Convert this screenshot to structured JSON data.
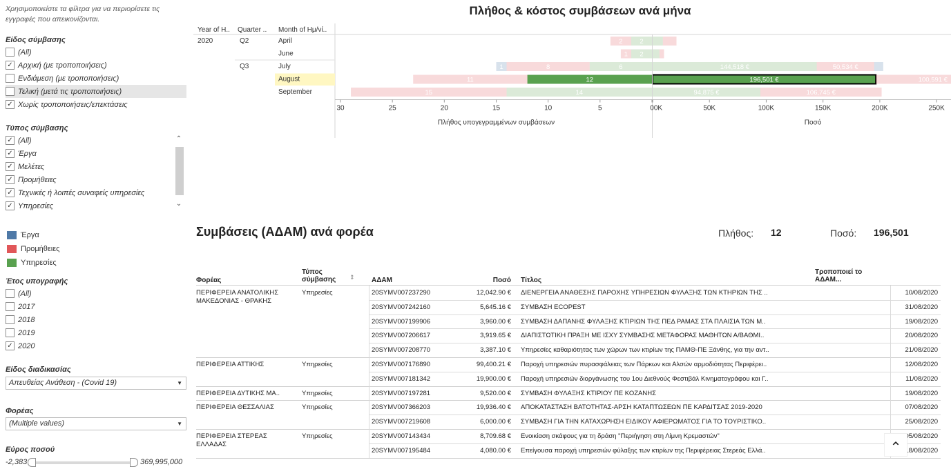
{
  "filters": {
    "hint": "Χρησιμοποιείστε τα φίλτρα για να περιορίσετε τις εγγραφές που απεικονίζονται.",
    "contract_kind": {
      "title": "Είδος σύμβασης",
      "items": [
        {
          "label": "(All)",
          "checked": false
        },
        {
          "label": "Αρχική (με τροποποιήσεις)",
          "checked": true
        },
        {
          "label": "Ενδιάμεση (με τροποποιήσεις)",
          "checked": false
        },
        {
          "label": "Τελική (μετά τις τροποποιήσεις)",
          "checked": false
        },
        {
          "label": "Χωρίς τροποποιήσεις/επεκτάσεις",
          "checked": true
        }
      ]
    },
    "contract_type": {
      "title": "Τύπος σύμβασης",
      "items": [
        {
          "label": "(All)",
          "checked": true
        },
        {
          "label": "Έργα",
          "checked": true
        },
        {
          "label": "Μελέτες",
          "checked": true
        },
        {
          "label": "Προμήθειες",
          "checked": true
        },
        {
          "label": "Τεχνικές ή λοιπές συναφείς υπηρεσίες",
          "checked": true
        },
        {
          "label": "Υπηρεσίες",
          "checked": true
        }
      ]
    },
    "legend": [
      {
        "label": "Έργα",
        "color": "#4e79a7"
      },
      {
        "label": "Προμήθειες",
        "color": "#e15759"
      },
      {
        "label": "Υπηρεσίες",
        "color": "#59a14f"
      }
    ],
    "sign_year": {
      "title": "Έτος υπογραφής",
      "items": [
        {
          "label": "(All)",
          "checked": false
        },
        {
          "label": "2017",
          "checked": false
        },
        {
          "label": "2018",
          "checked": false
        },
        {
          "label": "2019",
          "checked": false
        },
        {
          "label": "2020",
          "checked": true
        }
      ]
    },
    "procedure": {
      "title": "Είδος διαδικασίας",
      "value": "Απευθείας Ανάθεση - (Covid 19)"
    },
    "agency": {
      "title": "Φορέας",
      "value": "(Multiple values)"
    },
    "amount_range": {
      "title": "Εύρος ποσού",
      "min": "-2,383",
      "max": "369,995,000"
    }
  },
  "chart": {
    "title": "Πλήθος & κόστος συμβάσεων ανά μήνα",
    "headers": {
      "year": "Year of H..",
      "quarter": "Quarter ..",
      "month": "Month of Ημ/νί.."
    },
    "left_axis_label": "Πλήθος υπογεγραμμένων συμβάσεων",
    "right_axis_label": "Ποσό",
    "left_ticks": [
      "30",
      "25",
      "20",
      "15",
      "10",
      "5",
      "0"
    ],
    "right_ticks": [
      "0K",
      "50K",
      "100K",
      "150K",
      "200K",
      "250K"
    ]
  },
  "chart_data": {
    "type": "bar",
    "categories": [
      "2020 Q2 April",
      "2020 Q2 June",
      "2020 Q3 July",
      "2020 Q3 August",
      "2020 Q3 September"
    ],
    "years": [
      {
        "label": "2020",
        "row": 0
      }
    ],
    "quarters": [
      {
        "label": "Q2",
        "row": 0
      },
      {
        "label": "Q3",
        "row": 2
      }
    ],
    "months": [
      "April",
      "June",
      "July",
      "August",
      "September"
    ],
    "highlight": "August",
    "count_xlim": [
      0,
      30
    ],
    "amount_xlim": [
      0,
      270000
    ],
    "count_series": [
      {
        "name": "Έργα",
        "color": "#4e79a7",
        "values": [
          0,
          0,
          1,
          0,
          0
        ],
        "labels": [
          "",
          "",
          "1",
          "",
          ""
        ]
      },
      {
        "name": "Προμήθειες",
        "color": "#e15759",
        "values": [
          2,
          1,
          8,
          11,
          15
        ],
        "labels": [
          "2",
          "1",
          "8",
          "11",
          "15"
        ]
      },
      {
        "name": "Υπηρεσίες",
        "color": "#59a14f",
        "values": [
          2,
          2,
          6,
          12,
          14
        ],
        "labels": [
          "2",
          "2",
          "6",
          "12",
          "14"
        ]
      }
    ],
    "amount_series": [
      {
        "name": "Υπηρεσίες",
        "color": "#59a14f",
        "values": [
          9000,
          6000,
          144518,
          196501,
          94875
        ],
        "labels": [
          "",
          "",
          "144,518 €",
          "196,501 €",
          "94,875 €"
        ]
      },
      {
        "name": "Προμήθειες",
        "color": "#e15759",
        "values": [
          12000,
          4000,
          50534,
          100591,
          106745
        ],
        "labels": [
          "",
          "",
          "50,534 €",
          "100,591 €",
          "106,745 €"
        ]
      },
      {
        "name": "Έργα",
        "color": "#4e79a7",
        "values": [
          0,
          0,
          8000,
          0,
          0
        ],
        "labels": [
          "",
          "",
          "",
          "",
          ""
        ]
      }
    ]
  },
  "section": {
    "title": "Συμβάσεις (ΑΔΑΜ) ανά φορέα",
    "count_label": "Πλήθος:",
    "count_value": "12",
    "amount_label": "Ποσό:",
    "amount_value": "196,501"
  },
  "table": {
    "headers": {
      "agency": "Φορέας",
      "type": "Τύπος σύμβασης",
      "adam": "ΑΔΑΜ",
      "amount": "Ποσό",
      "title": "Τίτλος",
      "modifies": "Τροποποιεί το ΑΔΑΜ..."
    },
    "groups": [
      {
        "agency": "ΠΕΡΙΦΕΡΕΙΑ ΑΝΑΤΟΛΙΚΗΣ ΜΑΚΕΔΟΝΙΑΣ - ΘΡΑΚΗΣ",
        "type": "Υπηρεσίες",
        "rows": [
          {
            "adam": "20SYMV007237290",
            "amount": "12,042.90 €",
            "title": "ΔΙΕΝΕΡΓΕΙΑ ΑΝΑΘΕΣΗΣ ΠΑΡΟΧΗΣ ΥΠΗΡΕΣΙΩΝ ΦΥΛΑΞΗΣ ΤΩΝ ΚΤΗΡΙΩΝ ΤΗΣ ..",
            "date": "10/08/2020"
          },
          {
            "adam": "20SYMV007242160",
            "amount": "5,645.16 €",
            "title": "ΣΥΜΒΑΣΗ ECOPEST",
            "date": "31/08/2020"
          },
          {
            "adam": "20SYMV007199906",
            "amount": "3,960.00 €",
            "title": "ΣΥΜΒΑΣΗ ΔΑΠΑΝΗΣ ΦΥΛΑΞΗΣ ΚΤΙΡΙΩΝ ΤΗΣ ΠΕΔ ΡΑΜΑΣ ΣΤΑ ΠΛΑΙΣΙΑ ΤΩΝ Μ..",
            "date": "19/08/2020"
          },
          {
            "adam": "20SYMV007206617",
            "amount": "3,919.65 €",
            "title": "ΔΙΑΠΙΣΤΩΤΙΚΗ ΠΡΑΞΗ ΜΕ ΙΣΧΥ ΣΥΜΒΑΣΗΣ ΜΕΤΑΦΟΡΑΣ ΜΑΘΗΤΩΝ Α/ΒΑΘΜΙ..",
            "date": "20/08/2020"
          },
          {
            "adam": "20SYMV007208770",
            "amount": "3,387.10 €",
            "title": "Υπηρεσίες καθαριότητας των χώρων των κτιρίων της ΠΑΜΘ-ΠΕ Ξάνθης, για την αντ..",
            "date": "21/08/2020"
          }
        ]
      },
      {
        "agency": "ΠΕΡΙΦΕΡΕΙΑ ΑΤΤΙΚΗΣ",
        "type": "Υπηρεσίες",
        "rows": [
          {
            "adam": "20SYMV007176890",
            "amount": "99,400.21 €",
            "title": "Παροχή υπηρεσιών πυρασφάλειας των Πάρκων και Αλσών αρμοδιότητας Περιφέρει..",
            "date": "12/08/2020"
          },
          {
            "adam": "20SYMV007181342",
            "amount": "19,900.00 €",
            "title": "Παροχή υπηρεσιών διοργάνωσης του 1ου Διεθνούς Φεστιβάλ Κινηματογράφου και Γ..",
            "date": "11/08/2020"
          }
        ]
      },
      {
        "agency": "ΠΕΡΙΦΕΡΕΙΑ ΔΥΤΙΚΗΣ ΜΑ..",
        "type": "Υπηρεσίες",
        "rows": [
          {
            "adam": "20SYMV007197281",
            "amount": "9,520.00 €",
            "title": "ΣΥΜΒΑΣΗ ΦΥΛΑΞΗΣ ΚΤΙΡΙΟΥ ΠΕ ΚΟΖΑΝΗΣ",
            "date": "19/08/2020"
          }
        ]
      },
      {
        "agency": "ΠΕΡΙΦΕΡΕΙΑ ΘΕΣΣΑΛΙΑΣ",
        "type": "Υπηρεσίες",
        "rows": [
          {
            "adam": "20SYMV007366203",
            "amount": "19,936.40 €",
            "title": "ΑΠΟΚΑΤΑΣΤΑΣΗ ΒΑΤΟΤΗΤΑΣ-ΑΡΣΗ ΚΑΤΑΠΤΩΣΕΩΝ ΠΕ ΚΑΡΔΙΤΣΑΣ 2019-2020",
            "date": "07/08/2020"
          },
          {
            "adam": "20SYMV007219608",
            "amount": "6,000.00 €",
            "title": "ΣΥΜΒΑΣΗ ΓΙΑ ΤΗΝ ΚΑΤΑΧΩΡΗΣΗ ΕΙΔΙΚΟΥ ΑΦΙΕΡΩΜΑΤΟΣ ΓΙΑ ΤΟ ΤΟΥΡΙΣΤΙΚΟ..",
            "date": "25/08/2020"
          }
        ]
      },
      {
        "agency": "ΠΕΡΙΦΕΡΕΙΑ ΣΤΕΡΕΑΣ ΕΛΛΑΔΑΣ",
        "type": "Υπηρεσίες",
        "rows": [
          {
            "adam": "20SYMV007143434",
            "amount": "8,709.68 €",
            "title": "Ενοικίαση σκάφους για τη δράση \"Περιήγηση στη Λίμνη Κρεμαστών\"",
            "date": "05/08/2020"
          },
          {
            "adam": "20SYMV007195484",
            "amount": "4,080.00 €",
            "title": "Επείγουσα παροχή υπηρεσιών φύλαξης των κτιρίων της Περιφέρειας Στερεάς Ελλά..",
            "date": "18/08/2020"
          }
        ]
      }
    ]
  }
}
